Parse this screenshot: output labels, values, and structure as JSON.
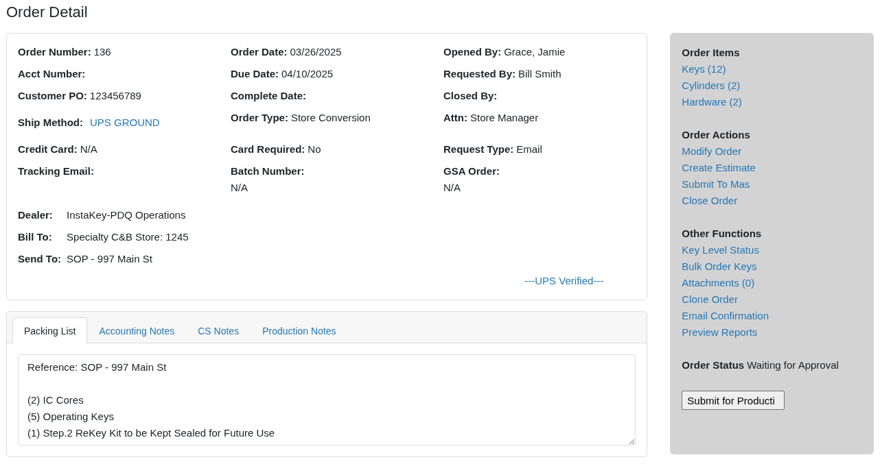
{
  "page_title": "Order Detail",
  "order_fields": [
    {
      "kind": "inline",
      "label": "Order Number:",
      "value": "136"
    },
    {
      "kind": "inline",
      "label": "Order Date:",
      "value": "03/26/2025"
    },
    {
      "kind": "inline",
      "label": "Opened By:",
      "value": "Grace, Jamie"
    },
    {
      "kind": "inline",
      "label": "Acct Number:"
    },
    {
      "kind": "inline",
      "label": "Due Date:",
      "value": "04/10/2025"
    },
    {
      "kind": "inline",
      "label": "Requested By:",
      "value": "Bill Smith"
    },
    {
      "kind": "inline",
      "label": "Customer PO:",
      "value": "123456789"
    },
    {
      "kind": "inline",
      "label": "Complete Date:"
    },
    {
      "kind": "inline",
      "label": "Closed By:"
    },
    {
      "kind": "link",
      "label": "Ship Method:",
      "value": "UPS GROUND"
    },
    {
      "kind": "inline",
      "label": "Order Type:",
      "value": "Store Conversion"
    },
    {
      "kind": "inline",
      "label": "Attn:",
      "value": "Store Manager"
    },
    {
      "kind": "inline",
      "label": "Credit Card:",
      "value": "N/A"
    },
    {
      "kind": "inline",
      "label": "Card Required:",
      "value": "No"
    },
    {
      "kind": "inline",
      "label": "Request Type:",
      "value": "Email"
    },
    {
      "kind": "inline",
      "label": "Tracking Email:"
    },
    {
      "kind": "stacked",
      "label": "Batch Number:",
      "value": "N/A"
    },
    {
      "kind": "stacked",
      "label": "GSA Order:",
      "value": "N/A"
    }
  ],
  "addresses": [
    {
      "label": "Dealer:",
      "value": "InstaKey-PDQ Operations"
    },
    {
      "label": "Bill To:",
      "value": "Specialty C&B Store: 1245"
    },
    {
      "label": "Send To:",
      "value": "SOP - 997 Main St"
    }
  ],
  "verification": "---UPS Verified---",
  "tabs": [
    {
      "label": "Packing List",
      "selected": true
    },
    {
      "label": "Accounting Notes",
      "selected": false
    },
    {
      "label": "CS Notes",
      "selected": false
    },
    {
      "label": "Production Notes",
      "selected": false
    }
  ],
  "packing_list": {
    "value": "Reference: SOP - 997 Main St\n\n(2) IC Cores\n(5) Operating Keys\n(1) Step.2 ReKey Kit to be Kept Sealed for Future Use"
  },
  "sidebar": {
    "sections": [
      {
        "title": "Order Items",
        "links": [
          "Keys (12)",
          "Cylinders (2)",
          "Hardware (2)"
        ]
      },
      {
        "title": "Order Actions",
        "links": [
          "Modify Order",
          "Create Estimate",
          "Submit To Mas",
          "Close Order"
        ]
      },
      {
        "title": "Other Functions",
        "links": [
          "Key Level Status",
          "Bulk Order Keys",
          "Attachments (0)",
          "Clone Order",
          "Email Confirmation",
          "Preview Reports"
        ]
      }
    ],
    "order_status": {
      "label": "Order Status",
      "value": "Waiting for Approval"
    },
    "submit_button": "Submit for Producti"
  }
}
